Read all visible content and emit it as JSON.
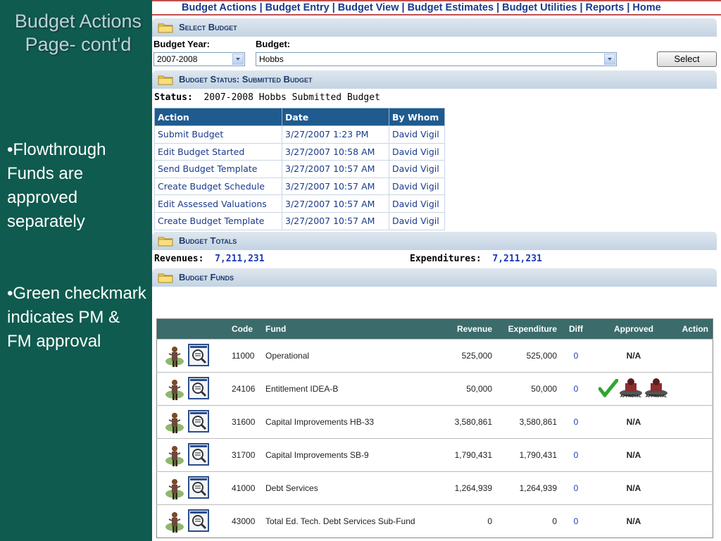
{
  "slide": {
    "title": "Budget Actions Page- cont'd",
    "bullet1": "•Flowthrough Funds are approved separately",
    "bullet2": "•Green checkmark indicates PM & FM approval"
  },
  "nav": [
    "Budget Actions",
    "Budget Entry",
    "Budget View",
    "Budget Estimates",
    "Budget Utilities",
    "Reports",
    "Home"
  ],
  "select_budget": {
    "header": "Select Budget",
    "year_label": "Budget Year:",
    "year_value": "2007-2008",
    "budget_label": "Budget:",
    "budget_value": "Hobbs",
    "button": "Select"
  },
  "status_section": {
    "header": "Budget Status: Submitted Budget",
    "status_label": "Status:",
    "status_value": "2007-2008 Hobbs Submitted Budget",
    "columns": [
      "Action",
      "Date",
      "By Whom"
    ],
    "rows": [
      [
        "Submit Budget",
        "3/27/2007 1:23 PM",
        "David Vigil"
      ],
      [
        "Edit Budget Started",
        "3/27/2007 10:58 AM",
        "David Vigil"
      ],
      [
        "Send Budget Template",
        "3/27/2007 10:57 AM",
        "David Vigil"
      ],
      [
        "Create Budget Schedule",
        "3/27/2007 10:57 AM",
        "David Vigil"
      ],
      [
        "Edit Assessed Valuations",
        "3/27/2007 10:57 AM",
        "David Vigil"
      ],
      [
        "Create Budget Template",
        "3/27/2007 10:57 AM",
        "David Vigil"
      ]
    ]
  },
  "totals": {
    "header": "Budget Totals",
    "rev_label": "Revenues:",
    "rev_value": "7,211,231",
    "exp_label": "Expenditures:",
    "exp_value": "7,211,231"
  },
  "funds": {
    "header": "Budget Funds",
    "columns": [
      "Code",
      "Fund",
      "Revenue",
      "Expenditure",
      "Diff",
      "Approved",
      "Action"
    ],
    "rows": [
      {
        "code": "11000",
        "fund": "Operational",
        "revenue": "525,000",
        "expenditure": "525,000",
        "diff": "0",
        "approved": "N/A"
      },
      {
        "code": "24106",
        "fund": "Entitlement IDEA-B",
        "revenue": "50,000",
        "expenditure": "50,000",
        "diff": "0",
        "approved": ""
      },
      {
        "code": "31600",
        "fund": "Capital Improvements HB-33",
        "revenue": "3,580,861",
        "expenditure": "3,580,861",
        "diff": "0",
        "approved": "N/A"
      },
      {
        "code": "31700",
        "fund": "Capital Improvements SB-9",
        "revenue": "1,790,431",
        "expenditure": "1,790,431",
        "diff": "0",
        "approved": "N/A"
      },
      {
        "code": "41000",
        "fund": "Debt Services",
        "revenue": "1,264,939",
        "expenditure": "1,264,939",
        "diff": "0",
        "approved": "N/A"
      },
      {
        "code": "43000",
        "fund": "Total Ed. Tech. Debt Services Sub-Fund",
        "revenue": "0",
        "expenditure": "0",
        "diff": "0",
        "approved": "N/A"
      }
    ],
    "approval_stamp_text": "APPROVAL"
  },
  "colors": {
    "nav_border": "#c0504d",
    "slide_bg": "#0f5b4f",
    "table_header": "#1f5b8f",
    "funds_header": "#3b6b6b",
    "check": "#2fa52f"
  }
}
